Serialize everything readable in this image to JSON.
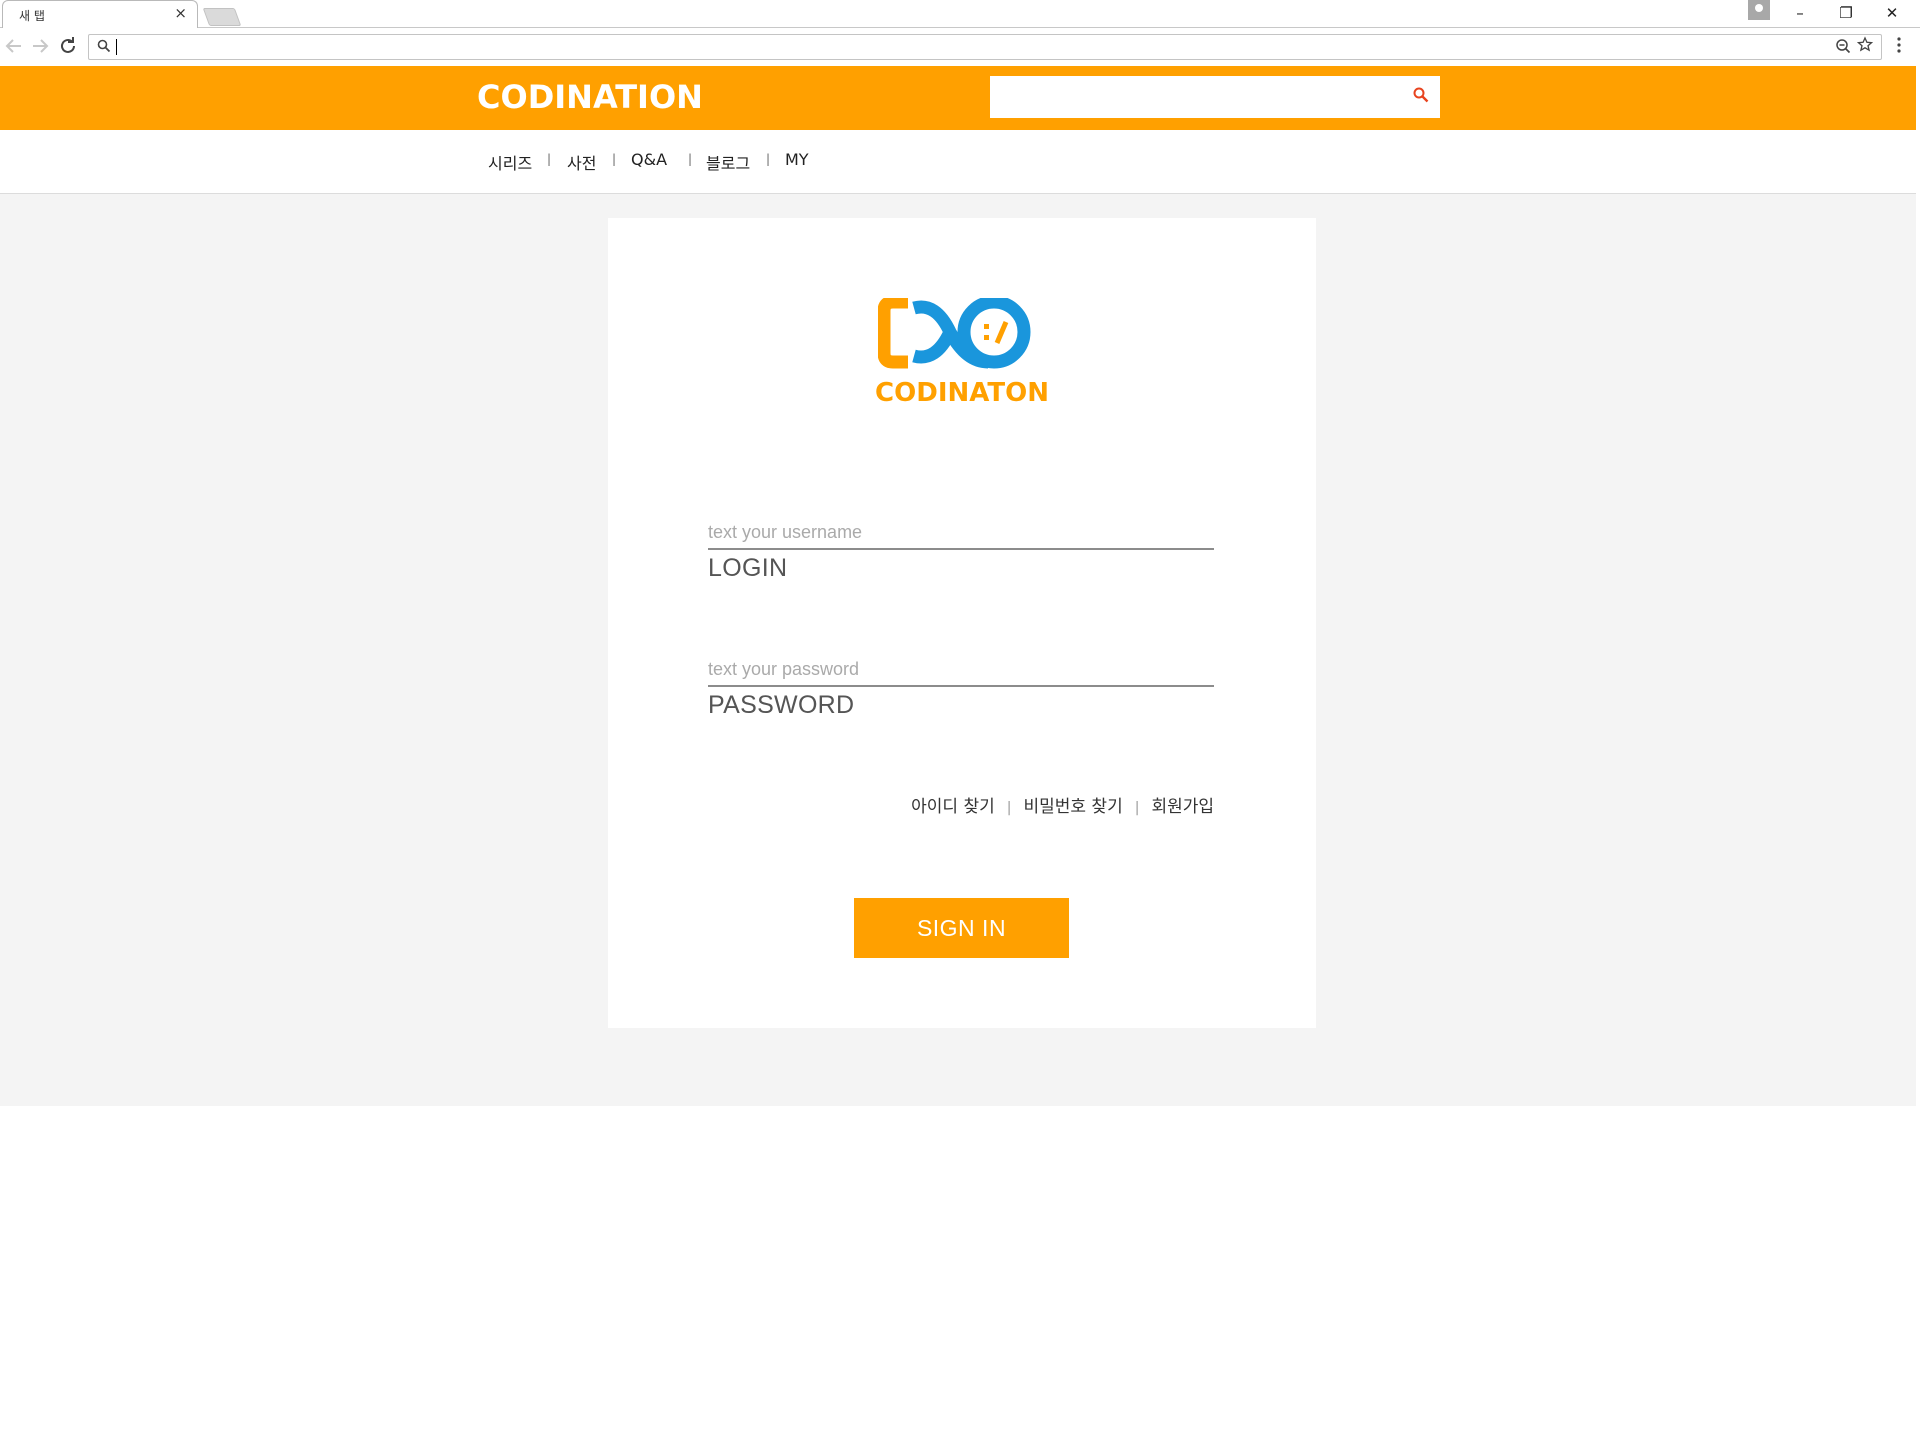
{
  "browser": {
    "tab_title": "새 탭",
    "tab_close": "×",
    "address": "",
    "window_controls": {
      "minimize": "–",
      "restore": "❐",
      "close": "✕"
    },
    "icons": [
      "back-arrow-icon",
      "forward-arrow-icon",
      "reload-icon",
      "search-icon",
      "zoom-icon",
      "star-icon",
      "menu-icon"
    ]
  },
  "header": {
    "logo": "CODINATION",
    "search_value": "",
    "accent_color": "#ffa000"
  },
  "nav": {
    "items": [
      "시리즈",
      "사전",
      "Q&A",
      "블로그",
      "MY"
    ],
    "separator": "|"
  },
  "login": {
    "brand_name": "CODINATON",
    "brand_colors": {
      "orange": "#ffa000",
      "blue": "#1a96dc"
    },
    "username": {
      "placeholder": "text your username",
      "label": "LOGIN",
      "value": ""
    },
    "password": {
      "placeholder": "text your password",
      "label": "PASSWORD",
      "value": ""
    },
    "links": {
      "find_id": "아이디 찾기",
      "find_password": "비밀번호 찾기",
      "signup": "회원가입",
      "separator": "|"
    },
    "signin_label": "SIGN IN"
  }
}
